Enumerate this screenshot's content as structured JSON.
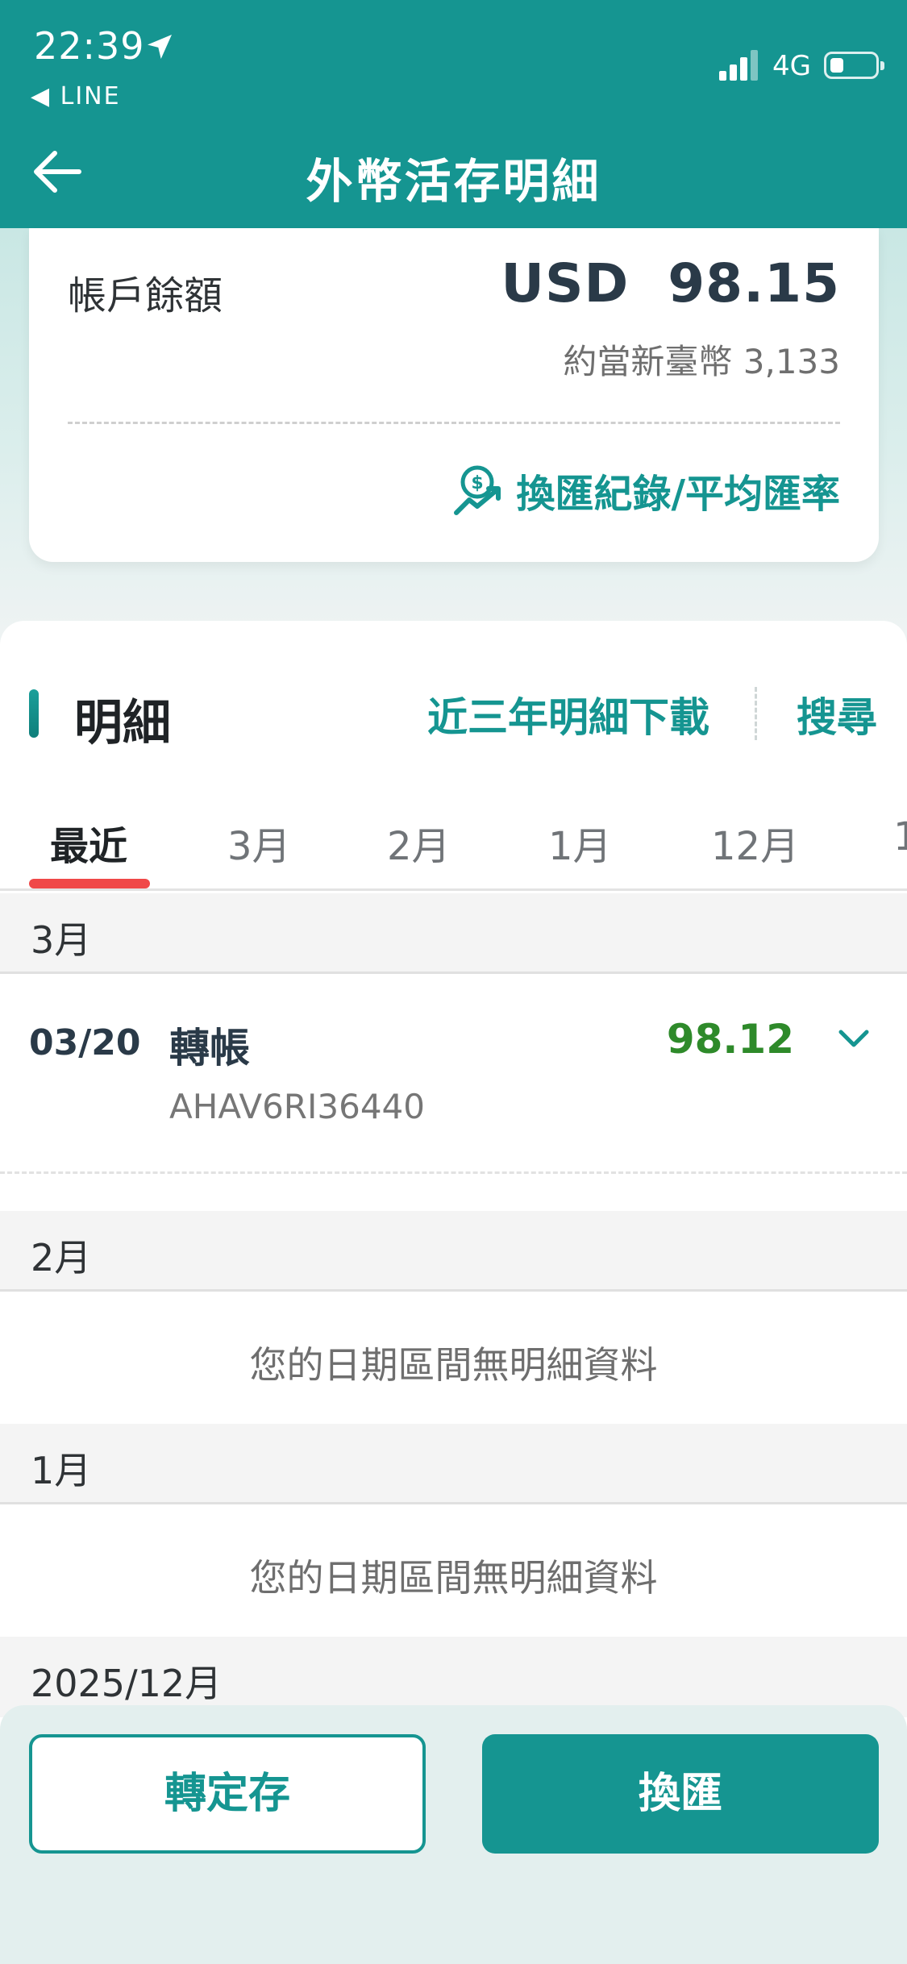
{
  "status_bar": {
    "time": "22:39",
    "back_app": "◀ LINE",
    "network": "4G"
  },
  "header": {
    "title": "外幣活存明細"
  },
  "balance": {
    "label": "帳戶餘額",
    "currency_amount": "USD  98.15",
    "twd_equivalent": "約當新臺幣 3,133",
    "fx_link": "換匯紀錄/平均匯率"
  },
  "details": {
    "title": "明細",
    "download_link": "近三年明細下載",
    "search_link": "搜尋",
    "tabs": [
      "最近",
      "3月",
      "2月",
      "1月",
      "12月",
      "1"
    ],
    "active_tab": "最近",
    "months": [
      {
        "label": "3月"
      },
      {
        "label": "2月",
        "empty_text": "您的日期區間無明細資料"
      },
      {
        "label": "1月",
        "empty_text": "您的日期區間無明細資料"
      },
      {
        "label": "2025/12月"
      }
    ],
    "transaction": {
      "date": "03/20",
      "type": "轉帳",
      "reference": "AHAV6RI36440",
      "amount": "98.12"
    }
  },
  "actions": {
    "time_deposit": "轉定存",
    "exchange": "換匯"
  },
  "colors": {
    "brand_teal": "#159591",
    "credit_green": "#2e8a2a",
    "tab_indicator": "#f04848"
  }
}
